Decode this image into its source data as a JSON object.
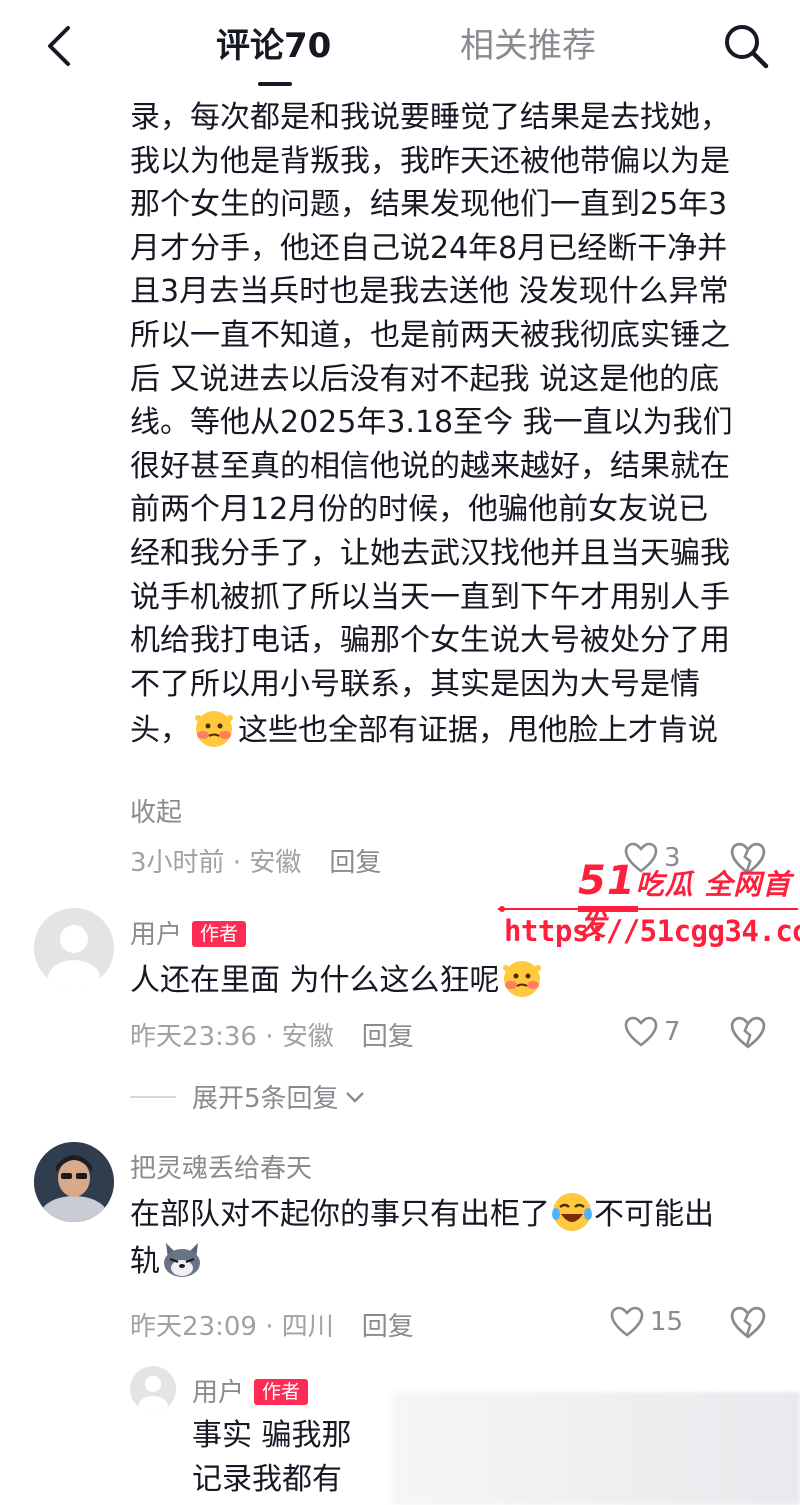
{
  "header": {
    "tab_comments": "评论70",
    "tab_related": "相关推荐"
  },
  "expanded_comment": {
    "text": "录，每次都是和我说要睡觉了结果是去找她，\n我以为他是背叛我，我昨天还被他带偏以为是\n那个女生的问题，结果发现他们一直到25年3\n月才分手，他还自己说24年8月已经断干净并\n且3月去当兵时也是我去送他 没发现什么异常\n所以一直不知道，也是前两天被我彻底实锤之\n后 又说进去以后没有对不起我 说这是他的底\n线。等他从2025年3.18至今 我一直以为我们\n很好甚至真的相信他说的越来越好，结果就在\n前两个月12月份的时候，他骗他前女友说已\n经和我分手了，让她去武汉找他并且当天骗我\n说手机被抓了所以当天一直到下午才用别人手\n机给我打电话，骗那个女生说大号被处分了用\n不了所以用小号联系，其实是因为大号是情",
    "last_line_before": "头，",
    "last_line_after": "这些也全部有证据，甩他脸上才肯说",
    "emoji": "blushing-face-emoji",
    "collapse": "收起",
    "time": "3小时前",
    "location": "安徽",
    "reply": "回复",
    "likes": "3"
  },
  "watermark": {
    "brand_num": "51",
    "brand_text": "吃瓜 全网首发",
    "url": "https://51cgg34.com"
  },
  "comment1": {
    "username": "用户",
    "badge": "作者",
    "text": "人还在里面 为什么这么狂呢",
    "emoji": "blushing-face-emoji",
    "time": "昨天23:36",
    "location": "安徽",
    "reply": "回复",
    "likes": "7",
    "expand_replies": "展开5条回复"
  },
  "comment2": {
    "username": "把灵魂丢给春天",
    "text_a": "在部队对不起你的事只有出柜了",
    "text_b": "不可能出",
    "text_c": "轨",
    "time": "昨天23:09",
    "location": "四川",
    "reply": "回复",
    "likes": "15"
  },
  "reply1": {
    "username": "用户",
    "badge": "作者",
    "line1": "事实 骗我那",
    "line2": "记录我都有"
  },
  "colors": {
    "accent": "#fe2c55",
    "watermark": "#ff1e3c",
    "muted": "#8a8b91"
  }
}
